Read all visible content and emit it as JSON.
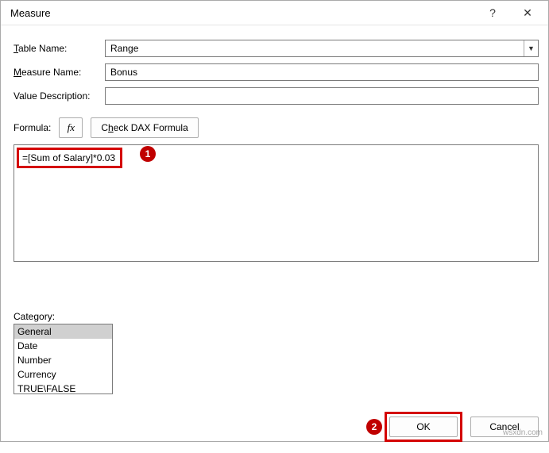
{
  "dialog": {
    "title": "Measure",
    "help": "?",
    "close": "✕"
  },
  "labels": {
    "table_name_pre": "T",
    "table_name_rest": "able Name:",
    "measure_name_pre": "M",
    "measure_name_rest": "easure Name:",
    "value_desc": "Value Description:",
    "formula_pre": "For",
    "formula_u": "m",
    "formula_post": "ula:",
    "fx": "fx",
    "check_dax_pre": "C",
    "check_dax_u": "h",
    "check_dax_post": "eck DAX Formula",
    "category_pre": "C",
    "category_rest": "ategory:"
  },
  "fields": {
    "table_name": "Range",
    "measure_name": "Bonus",
    "value_description": "",
    "formula_text": "=[Sum of Salary]*0.03"
  },
  "category": {
    "items": [
      "General",
      "Date",
      "Number",
      "Currency",
      "TRUE\\FALSE"
    ],
    "selected_index": 0
  },
  "buttons": {
    "ok": "OK",
    "cancel": "Cancel"
  },
  "callouts": {
    "one": "1",
    "two": "2"
  },
  "watermark": "wsxdn.com"
}
